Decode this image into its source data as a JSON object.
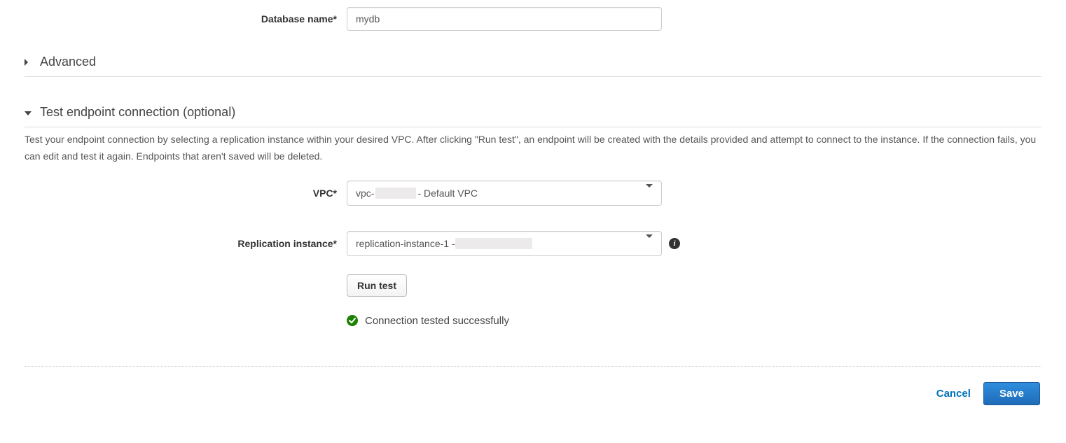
{
  "db": {
    "label": "Database name*",
    "value": "mydb"
  },
  "advanced": {
    "title": "Advanced"
  },
  "test": {
    "title": "Test endpoint connection (optional)",
    "description": "Test your endpoint connection by selecting a replication instance within your desired VPC. After clicking \"Run test\", an endpoint will be created with the details provided and attempt to connect to the instance. If the connection fails, you can edit and test it again. Endpoints that aren't saved will be deleted.",
    "vpc_label": "VPC*",
    "vpc_value_prefix": "vpc-",
    "vpc_value_suffix": " - Default VPC",
    "replication_label": "Replication instance*",
    "replication_value_prefix": "replication-instance-1 - ",
    "run_test_label": "Run test",
    "status_text": "Connection tested successfully"
  },
  "footer": {
    "cancel": "Cancel",
    "save": "Save"
  }
}
